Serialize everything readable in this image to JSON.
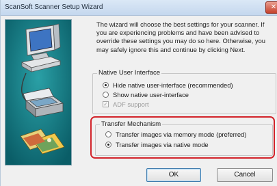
{
  "window": {
    "title": "ScanSoft Scanner Setup Wizard",
    "close_glyph": "✕"
  },
  "intro_text": "The wizard will choose the best settings for your scanner. If you are experiencing problems and have been advised to override these settings you may do so here. Otherwise, you may safely ignore this and continue by clicking Next.",
  "native_ui": {
    "label": "Native User Interface",
    "options": [
      {
        "label": "Hide native user-interface (recommended)",
        "selected": true
      },
      {
        "label": "Show native user-interface",
        "selected": false
      }
    ],
    "adf": {
      "label": "ADF support",
      "checked": true,
      "disabled": true,
      "glyph": "✓"
    }
  },
  "transfer": {
    "label": "Transfer Mechanism",
    "options": [
      {
        "label": "Transfer images via memory mode (preferred)",
        "selected": false
      },
      {
        "label": "Transfer images via native mode",
        "selected": true
      }
    ]
  },
  "buttons": {
    "ok": "OK",
    "cancel": "Cancel"
  },
  "colors": {
    "highlight": "#d2232a",
    "art_background": "#0d6f79"
  },
  "icons": [
    "computer-icon",
    "scanner-icon",
    "photos-icon",
    "close-icon"
  ]
}
